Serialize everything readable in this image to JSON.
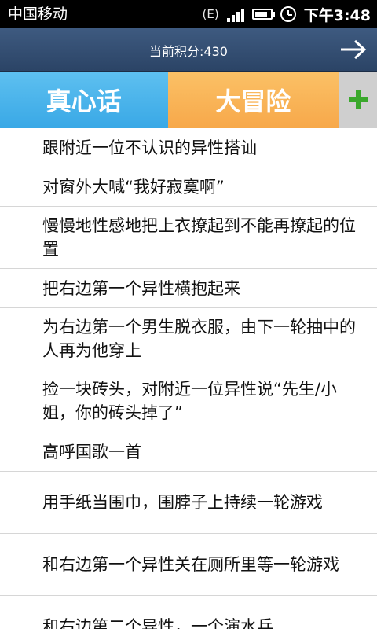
{
  "status_bar": {
    "carrier": "中国移动",
    "network": "(E)",
    "time": "下午3:48",
    "icons": [
      "signal-icon",
      "battery-icon",
      "alarm-clock-icon"
    ],
    "battery_level": 0.85
  },
  "header": {
    "score_text": "当前积分:430",
    "next_icon": "arrow-right-icon"
  },
  "tabs": {
    "truth_label": "真心话",
    "dare_label": "大冒险",
    "add_icon": "plus-icon"
  },
  "colors": {
    "truth_tab": "#4cb6ee",
    "dare_tab": "#f9b65a",
    "add_plus": "#3aa82c",
    "header": "#34506f"
  },
  "list": {
    "items": [
      "跟附近一位不认识的异性搭讪",
      "对窗外大喊“我好寂寞啊”",
      "慢慢地性感地把上衣撩起到不能再撩起的位置",
      "把右边第一个异性横抱起来",
      "为右边第一个男生脱衣服，由下一轮抽中的人再为他穿上",
      "捡一块砖头，对附近一位异性说“先生/小姐，你的砖头掉了”",
      "高呼国歌一首",
      "用手纸当围巾，围脖子上持续一轮游戏",
      "和右边第一个异性关在厕所里等一轮游戏",
      "和右边第二个异性，一个演水兵"
    ]
  }
}
